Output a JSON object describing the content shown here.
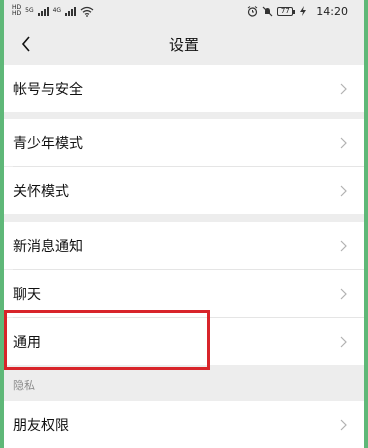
{
  "status_bar": {
    "sim1": "HD",
    "sim2": "HD",
    "net1": "5G",
    "net2": "4G",
    "battery": "77",
    "time": "14:20"
  },
  "nav": {
    "title": "设置"
  },
  "settings": {
    "account_security": "帐号与安全",
    "teen_mode": "青少年模式",
    "care_mode": "关怀模式",
    "notifications": "新消息通知",
    "chat": "聊天",
    "general": "通用",
    "privacy_header": "隐私",
    "friend_permissions": "朋友权限"
  },
  "colors": {
    "background": "#ededed",
    "cell": "#ffffff",
    "highlight": "#d8242a",
    "frame_border": "#5fb878"
  }
}
